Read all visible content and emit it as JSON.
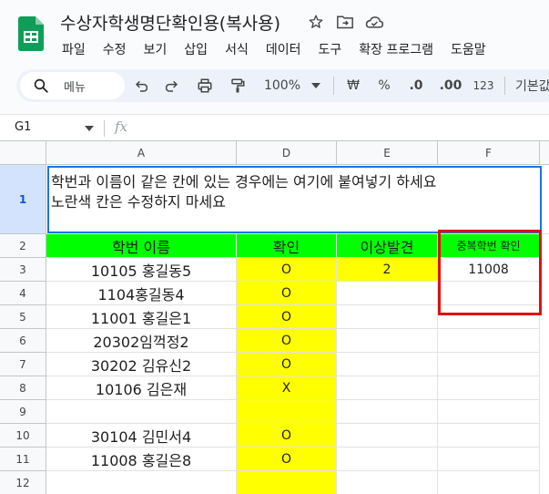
{
  "doc": {
    "title": "수상자학생명단확인용(복사용)"
  },
  "menu": [
    "파일",
    "수정",
    "보기",
    "삽입",
    "서식",
    "데이터",
    "도구",
    "확장 프로그램",
    "도움말"
  ],
  "toolbar": {
    "search_label": "메뉴",
    "zoom": "100%",
    "currency": "₩",
    "percent": "%",
    "dec_decrease": ".0",
    "dec_increase": ".00",
    "number_format": "123",
    "default_format": "기본값"
  },
  "namebox": {
    "cell": "G1",
    "fx": "fx"
  },
  "columns": [
    "A",
    "D",
    "E",
    "F"
  ],
  "rows": [
    "1",
    "2",
    "3",
    "4",
    "5",
    "6",
    "7",
    "8",
    "9",
    "10",
    "11",
    "12"
  ],
  "note": {
    "line1": "학번과 이름이 같은 칸에 있는 경우에는 여기에 붙여넣기 하세요",
    "line2": "노란색 칸은 수정하지 마세요"
  },
  "header_row": {
    "a": "학번 이름",
    "d": "확인",
    "e": "이상발견",
    "f": "중복학번 확인"
  },
  "data_rows": [
    {
      "a": "10105 홍길동5",
      "d": "O",
      "e": "2",
      "f": "11008"
    },
    {
      "a": "1104홍길동4",
      "d": "O",
      "e": "",
      "f": ""
    },
    {
      "a": "11001 홍길은1",
      "d": "O",
      "e": "",
      "f": ""
    },
    {
      "a": "20302임꺽정2",
      "d": "O",
      "e": "",
      "f": ""
    },
    {
      "a": "30202 김유신2",
      "d": "O",
      "e": "",
      "f": ""
    },
    {
      "a": "10106 김은재",
      "d": "X",
      "e": "",
      "f": ""
    },
    {
      "a": "",
      "d": "",
      "e": "",
      "f": ""
    },
    {
      "a": "30104 김민서4",
      "d": "O",
      "e": "",
      "f": ""
    },
    {
      "a": "11008 홍길은8",
      "d": "O",
      "e": "",
      "f": ""
    },
    {
      "a": "",
      "d": "",
      "e": "",
      "f": ""
    }
  ],
  "colors": {
    "yellow": "#ffff00",
    "green": "#00ff00",
    "highlight": "#e01010",
    "selection": "#1a73e8"
  }
}
